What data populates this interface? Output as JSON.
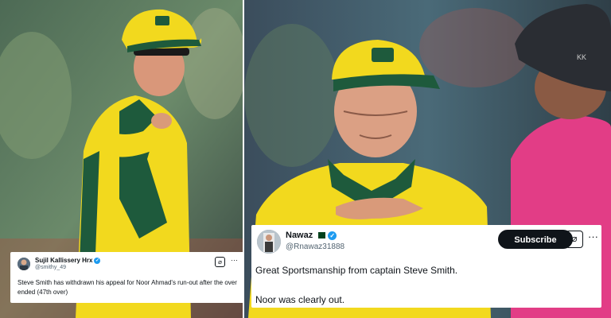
{
  "left_tweet": {
    "name": "Sujil Kallissery Hrx",
    "handle": "@smithy_49",
    "text": "Steve Smith has withdrawn his appeal for Noor Ahmad's run-out after the over ended (47th over)"
  },
  "right_tweet": {
    "name": "Nawaz",
    "handle": "@Rnawaz31888",
    "subscribe_label": "Subscribe",
    "line1": "Great Sportsmanship from captain Steve Smith.",
    "line2": "Noor was clearly out."
  },
  "colors": {
    "jersey_yellow": "#f2d91e",
    "jersey_green": "#1e5a3c",
    "umpire_pink": "#e23d86",
    "verified_blue": "#1d9bf0"
  }
}
